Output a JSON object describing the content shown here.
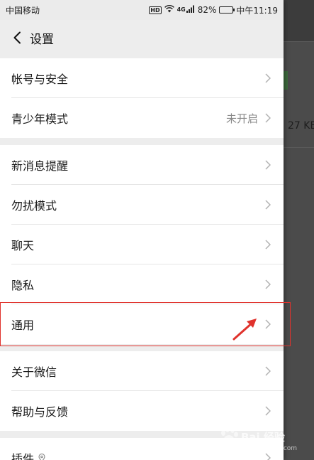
{
  "statusbar": {
    "carrier": "中国移动",
    "hd": "HD",
    "network": "4G",
    "battery": "82%",
    "battery_level": 0.82,
    "time": "中午11:19"
  },
  "navbar": {
    "title": "设置"
  },
  "groups": [
    {
      "items": [
        {
          "label": "帐号与安全"
        },
        {
          "label": "青少年模式",
          "value": "未开启"
        }
      ]
    },
    {
      "items": [
        {
          "label": "新消息提醒"
        },
        {
          "label": "勿扰模式"
        },
        {
          "label": "聊天"
        },
        {
          "label": "隐私"
        },
        {
          "label": "通用"
        }
      ]
    },
    {
      "items": [
        {
          "label": "关于微信"
        },
        {
          "label": "帮助与反馈"
        }
      ]
    },
    {
      "items": [
        {
          "label": "插件"
        }
      ]
    }
  ],
  "background_app": {
    "fragment_text": "27 KE"
  },
  "watermark": {
    "text": "Bai 经验",
    "sub": "jingyan.baidu.com"
  },
  "colors": {
    "highlight": "#e0322c",
    "panel_bg": "#ededed"
  }
}
